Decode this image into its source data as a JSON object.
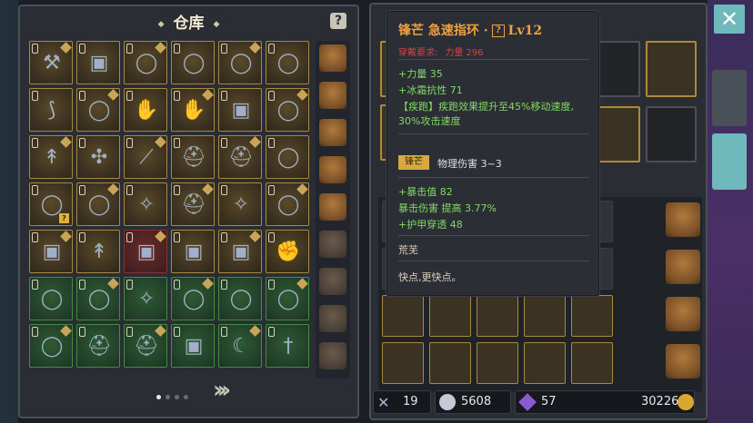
{
  "warehouse": {
    "title": "仓库",
    "help_icon": "question-icon",
    "page_indicator": {
      "pages": 4,
      "current": 1
    },
    "next_icon": "double-chevron-right-icon",
    "items": [
      [
        "mace",
        "armor",
        "ring",
        "ring",
        "ring",
        "ring"
      ],
      [
        "bow",
        "ring",
        "gloves",
        "gloves",
        "armor",
        "ring"
      ],
      [
        "spear",
        "crossbow",
        "wand",
        "helmet",
        "helmet",
        "ring"
      ],
      [
        "ring",
        "ring",
        "amulet",
        "helmet",
        "amulet",
        "ring"
      ],
      [
        "armor",
        "spear",
        "armor",
        "armor",
        "armor",
        "gauntlet"
      ],
      [
        "ring",
        "ring",
        "amulet",
        "ring",
        "ring",
        "ring"
      ],
      [
        "ring",
        "helmet",
        "helmet",
        "armor",
        "blade",
        "sword"
      ]
    ],
    "bag_count": 9
  },
  "tooltip": {
    "name": "锋芒 急速指环 ·",
    "help": "?",
    "level": "Lv12",
    "requirement_label": "穿戴要求:",
    "requirement_value": "力量 296",
    "stats": [
      "+力量 35",
      "+冰霜抗性 71"
    ],
    "ability_line1": "【疾跑】疾跑效果提升至45%移动速度,",
    "ability_line2": "30%攻击速度",
    "skill_tag": "锋芒",
    "skill_damage": "物理伤害 3~3",
    "bonus": [
      "+暴击值 82",
      "暴击伤害 提高 3.77%",
      "+护甲穿透 48"
    ],
    "set_name": "荒芜",
    "flavor": "快点,更快点。"
  },
  "footer": {
    "attack": "19",
    "defense": "5608",
    "gems": "57",
    "gold": "30226"
  },
  "icons": {
    "close": "close-icon",
    "helmet_tab": "helmet-icon",
    "armor_tab": "armor-icon"
  }
}
